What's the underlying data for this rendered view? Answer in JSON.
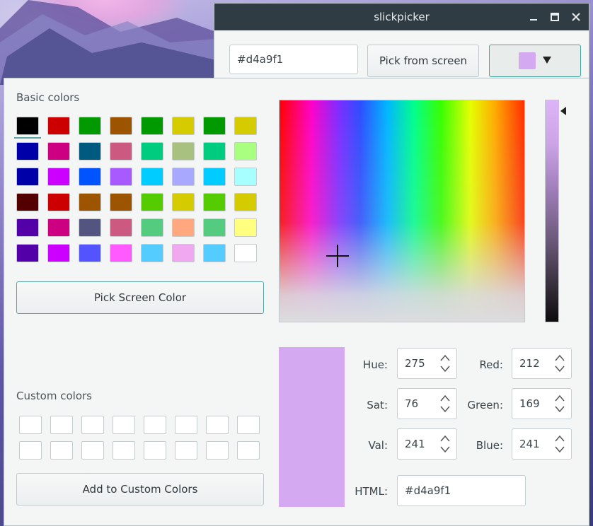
{
  "window": {
    "title": "slickpicker",
    "hex_value": "#d4a9f1",
    "pick_from_screen_label": "Pick from screen",
    "current_color": "#d4a9f1",
    "dropdown_icon": "triangle-down-icon"
  },
  "dialog": {
    "basic_colors_label": "Basic colors",
    "basic_colors": [
      "#000000",
      "#cc0000",
      "#009900",
      "#9c5400",
      "#009900",
      "#d4cc00",
      "#009900",
      "#d4cc00",
      "#0000a8",
      "#cc0080",
      "#005a80",
      "#cc5a80",
      "#00cc80",
      "#a8c080",
      "#00cc80",
      "#a8ff80",
      "#0000a8",
      "#cc00ff",
      "#0054ff",
      "#a85aff",
      "#00ccff",
      "#a8a8ff",
      "#00ccff",
      "#a8ffff",
      "#540000",
      "#cc0000",
      "#9c5400",
      "#9c5400",
      "#54cc00",
      "#d4cc00",
      "#54cc00",
      "#d4cc00",
      "#5400a8",
      "#cc0080",
      "#545480",
      "#cc5a80",
      "#54cc80",
      "#ffa880",
      "#54cc80",
      "#ffff80",
      "#5400a8",
      "#cc00ff",
      "#5454ff",
      "#ff5aff",
      "#54ccff",
      "#f0a8f0",
      "#54ccff",
      "#ffffff"
    ],
    "selected_basic_index": 0,
    "pick_screen_color_label": "Pick Screen Color",
    "custom_colors_label": "Custom colors",
    "custom_colors_count": 16,
    "add_to_custom_label": "Add to Custom Colors",
    "preview_color": "#d4a9f1",
    "fields": {
      "hue": {
        "label": "Hue:",
        "value": "275"
      },
      "sat": {
        "label": "Sat:",
        "value": "76"
      },
      "val": {
        "label": "Val:",
        "value": "241"
      },
      "red": {
        "label": "Red:",
        "value": "212"
      },
      "green": {
        "label": "Green:",
        "value": "169"
      },
      "blue": {
        "label": "Blue:",
        "value": "241"
      },
      "html": {
        "label": "HTML:",
        "value": "#d4a9f1"
      }
    }
  }
}
